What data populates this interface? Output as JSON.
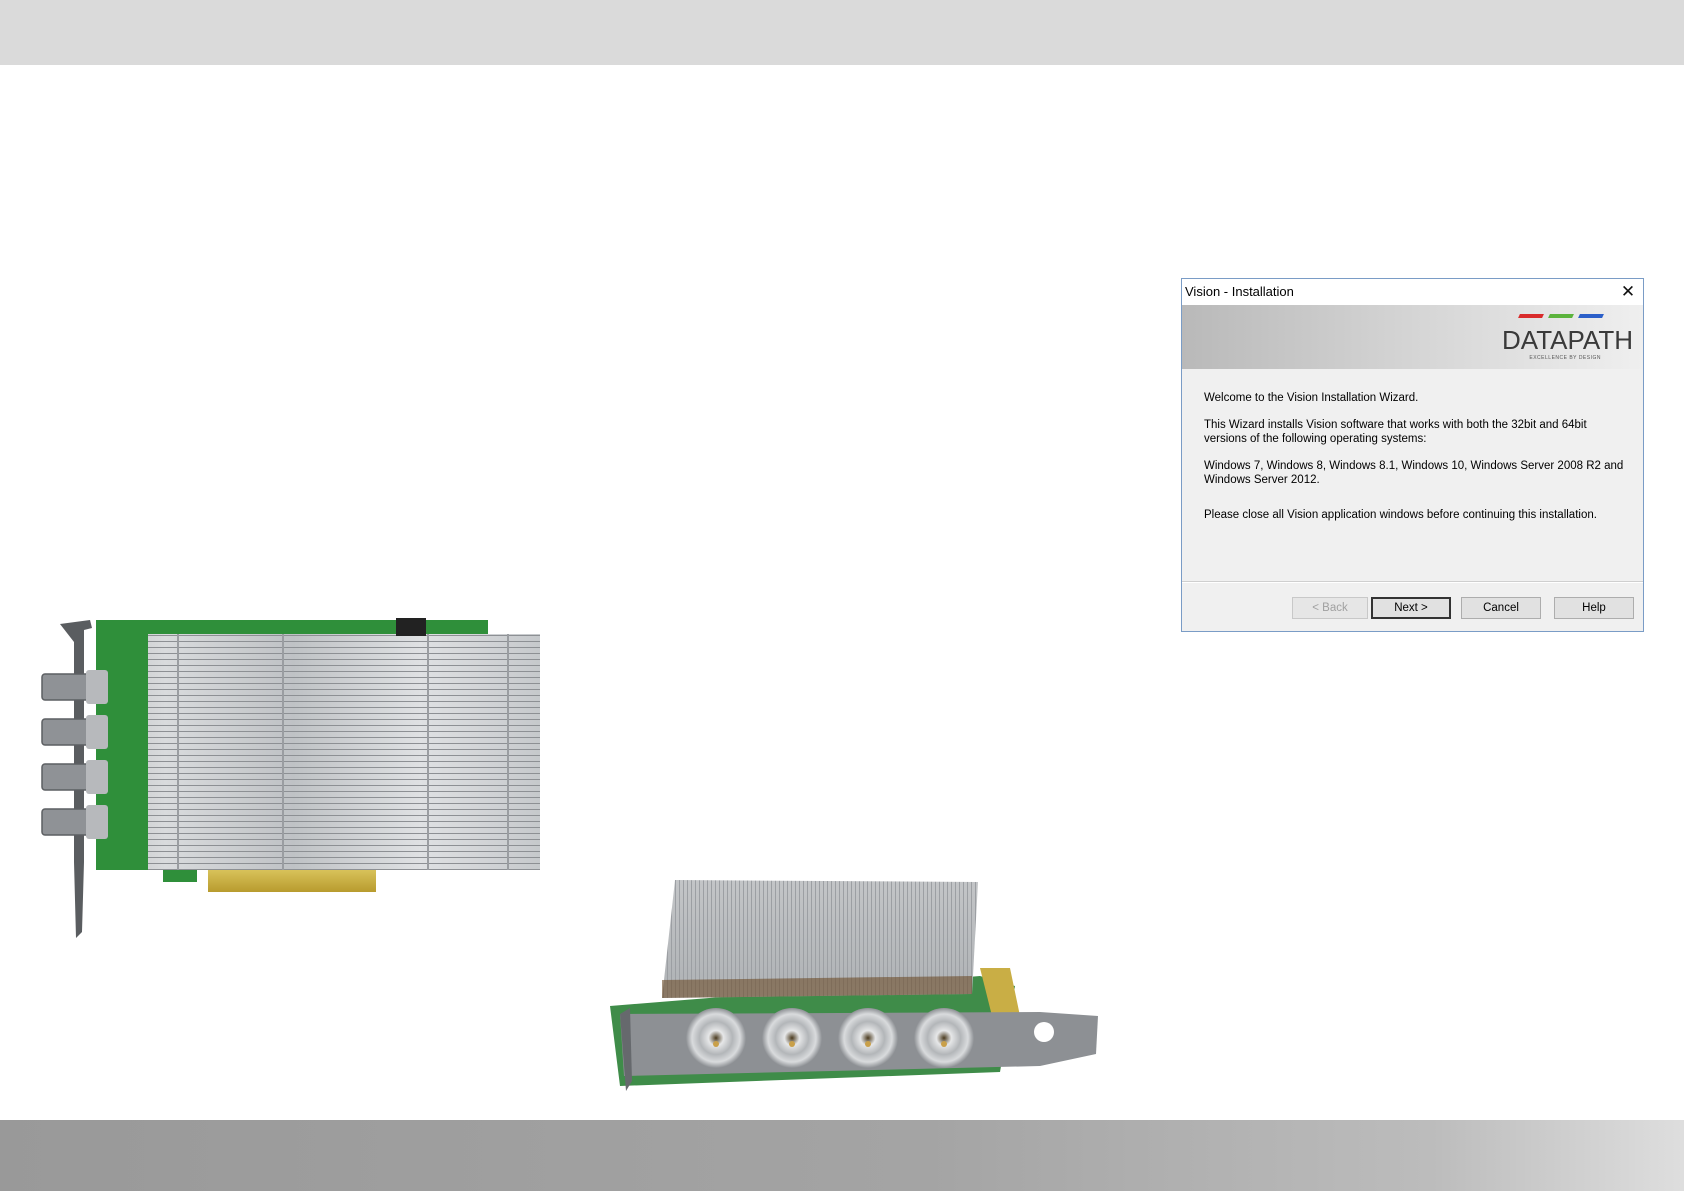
{
  "dialog": {
    "title": "Vision - Installation",
    "close_symbol": "✕",
    "logo": {
      "word": "DATAPATH",
      "tagline": "EXCELLENCE BY DESIGN",
      "bar_colors": [
        "#d92b2b",
        "#5bb33c",
        "#2b5fc9"
      ]
    },
    "body": {
      "welcome": "Welcome to the Vision Installation Wizard.",
      "intro": "This Wizard installs Vision software that works with both the 32bit and 64bit versions of the following operating systems:",
      "os_list": "Windows 7, Windows 8, Windows 8.1, Windows 10, Windows Server 2008 R2 and Windows Server 2012.",
      "note": "Please close all Vision application windows before continuing this installation."
    },
    "buttons": {
      "back": "< Back",
      "next": "Next >",
      "cancel": "Cancel",
      "help": "Help"
    }
  },
  "colors": {
    "top_band": "#dadada",
    "bottom_band": "#a4a4a4",
    "pcb_green": "#2f8f3a",
    "heatsink": "#c9cbcd"
  },
  "images": {
    "card_side_view": "capture-card-side-view",
    "card_front_view": "capture-card-front-view"
  }
}
